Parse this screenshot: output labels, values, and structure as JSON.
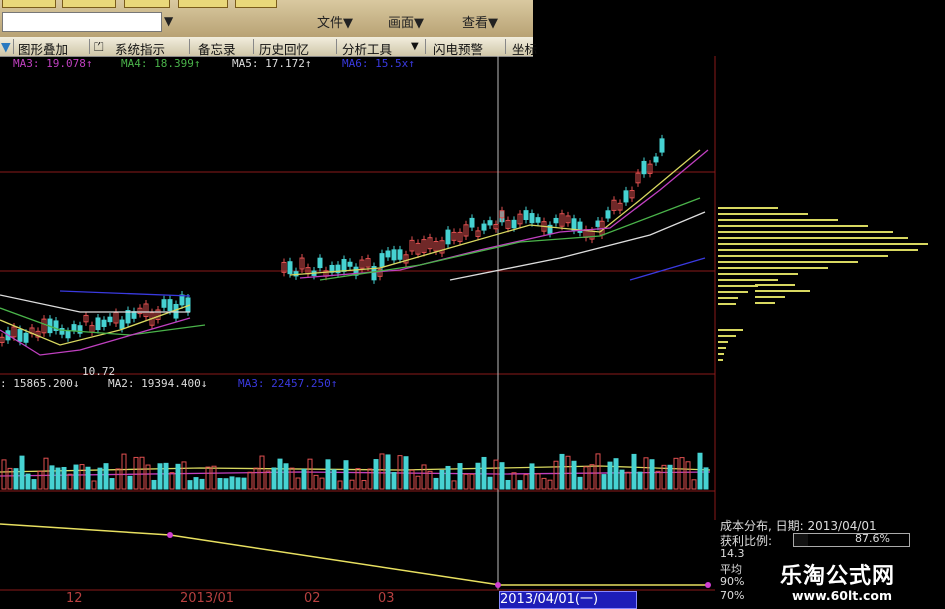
{
  "toolbar_top": {
    "menu_file": "文件▼",
    "menu_draw": "画面▼",
    "menu_view": "查看▼"
  },
  "toolbar": {
    "items": [
      "▼",
      "图形叠加",
      "⏍",
      "系统指示",
      "备忘录",
      "历史回忆",
      "分析工具",
      "▼",
      "闪电预警",
      "坐标"
    ]
  },
  "ma_legend": {
    "ma3": "MA3: 19.078↑",
    "ma4": "MA4: 18.399↑",
    "ma5": "MA5: 17.172↑",
    "ma6": "MA6: 15.5x↑"
  },
  "vol_legend": {
    "ma1": ": 15865.200↓",
    "ma2": "MA2: 19394.400↓",
    "ma3": "MA3: 22457.250↑"
  },
  "low_label": "10.72",
  "cost_panel": {
    "title": "成本分布, 日期: 2013/04/01",
    "profit_label": "获利比例:",
    "profit_value": "87.6%",
    "price_line": "14.3",
    "avg_label": "平均",
    "p90_label": "90%",
    "p70_label": "70%"
  },
  "x_axis": {
    "m12": "12",
    "m2013_01": "2013/01",
    "m02": "02",
    "m03": "03",
    "cursor_date": "2013/04/01(一)"
  },
  "watermark": {
    "cn": "乐淘公式网",
    "url": "www.60lt.com"
  },
  "colors": {
    "up_candle": "#e05050",
    "down_candle": "#46d2d2",
    "ma_yellow": "#d8d860",
    "ma_green": "#4ab34a",
    "ma_purple": "#c040c0",
    "ma_white": "#dddddd",
    "ma_blue": "#3a3ae0",
    "grid_red": "#8a1a1a"
  },
  "chart_data": {
    "type": "candlestick",
    "price_low_label": 10.72,
    "moving_averages": [
      {
        "name": "MA3",
        "value": 19.078
      },
      {
        "name": "MA4",
        "value": 18.399
      },
      {
        "name": "MA5",
        "value": 17.172
      }
    ],
    "volume_mas": [
      {
        "name": "MA2",
        "value": 19394.4
      },
      {
        "name": "MA3",
        "value": 22457.25
      }
    ],
    "cursor_date": "2013/04/01"
  }
}
